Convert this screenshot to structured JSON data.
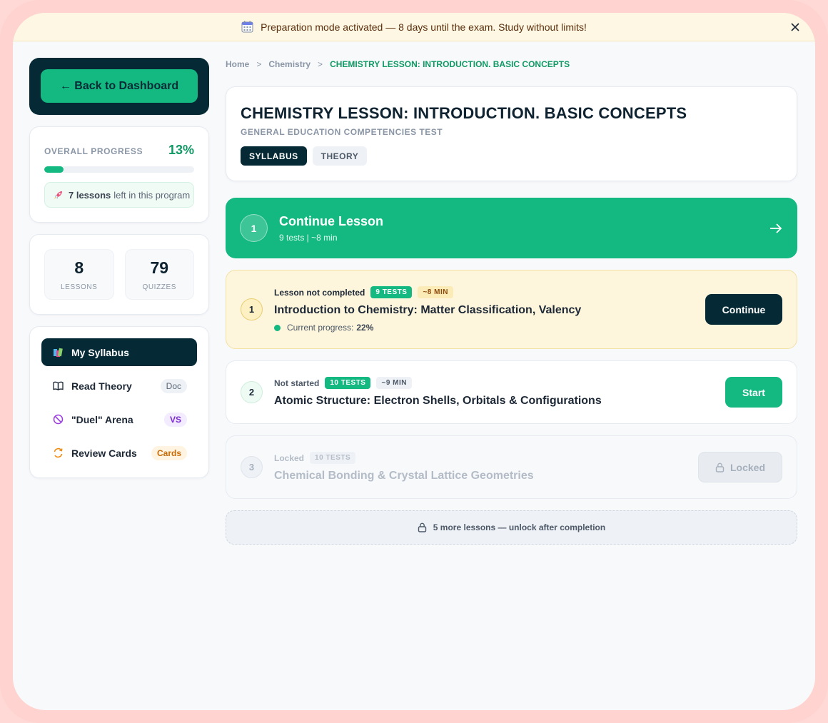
{
  "banner": {
    "text": "Preparation mode activated — 8 days until the exam. Study without limits!",
    "close_label": "✕"
  },
  "sidebar": {
    "back_label": "← Back to Dashboard",
    "progress": {
      "label": "OVERALL PROGRESS",
      "percent_text": "13%",
      "percent": 13,
      "lessons_left_bold": "7 lessons",
      "lessons_left_rest": "left in this program"
    },
    "stats": [
      {
        "value": "8",
        "label": "LESSONS"
      },
      {
        "value": "79",
        "label": "QUIZZES"
      }
    ],
    "nav": [
      {
        "label": "My Syllabus",
        "icon": "books-icon",
        "badge": ""
      },
      {
        "label": "Read Theory",
        "icon": "book-open-icon",
        "badge": "Doc"
      },
      {
        "label": "\"Duel\" Arena",
        "icon": "prohibited-icon",
        "badge": "VS"
      },
      {
        "label": "Review Cards",
        "icon": "refresh-icon",
        "badge": "Cards"
      }
    ]
  },
  "breadcrumb": {
    "items": [
      "Home",
      "Chemistry",
      "CHEMISTRY LESSON: INTRODUCTION. BASIC CONCEPTS"
    ],
    "separator": ">"
  },
  "header": {
    "title": "CHEMISTRY LESSON: INTRODUCTION. BASIC CONCEPTS",
    "subtitle": "GENERAL EDUCATION COMPETENCIES TEST",
    "tabs": [
      "SYLLABUS",
      "THEORY"
    ]
  },
  "continue_hero": {
    "number": "1",
    "title": "Continue Lesson",
    "sub": "9 tests | ~8 min"
  },
  "lessons": [
    {
      "number": "1",
      "status": "Lesson not completed",
      "tests": "9 TESTS",
      "time": "~8 MIN",
      "title": "Introduction to Chemistry: Matter Classification, Valency",
      "progress_label": "Current progress:",
      "progress_value": "22%",
      "button": "Continue"
    },
    {
      "number": "2",
      "status": "Not started",
      "tests": "10 TESTS",
      "time": "~9 MIN",
      "title": "Atomic Structure: Electron Shells, Orbitals & Configurations",
      "button": "Start"
    },
    {
      "number": "3",
      "status": "Locked",
      "tests": "10 TESTS",
      "title": "Chemical Bonding & Crystal Lattice Geometries",
      "button": "Locked"
    }
  ],
  "more_lessons": "5 more lessons — unlock after completion",
  "colors": {
    "accent": "#13b981",
    "dark": "#052a36",
    "banner_bg": "#fef7e3",
    "frame": "#ffd3cf"
  }
}
